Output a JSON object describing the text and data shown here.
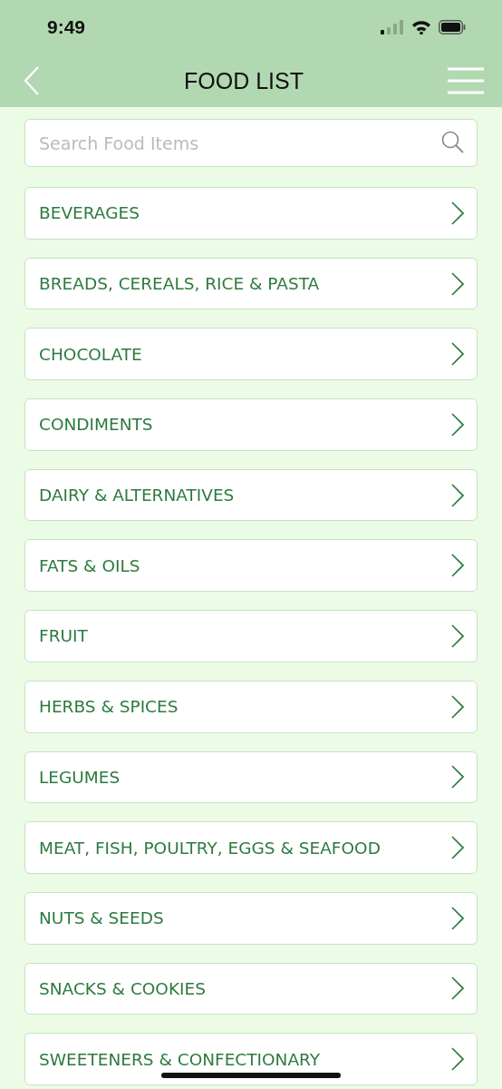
{
  "status_bar": {
    "time": "9:49"
  },
  "header": {
    "title": "FOOD LIST"
  },
  "search": {
    "placeholder": "Search Food Items"
  },
  "categories": [
    {
      "label": "BEVERAGES"
    },
    {
      "label": "BREADS, CEREALS, RICE & PASTA"
    },
    {
      "label": "CHOCOLATE"
    },
    {
      "label": "CONDIMENTS"
    },
    {
      "label": "DAIRY & ALTERNATIVES"
    },
    {
      "label": "FATS & OILS"
    },
    {
      "label": "FRUIT"
    },
    {
      "label": "HERBS & SPICES"
    },
    {
      "label": "LEGUMES"
    },
    {
      "label": "MEAT, FISH, POULTRY, EGGS & SEAFOOD"
    },
    {
      "label": "NUTS & SEEDS"
    },
    {
      "label": "SNACKS & COOKIES"
    },
    {
      "label": "SWEETENERS & CONFECTIONARY"
    }
  ]
}
